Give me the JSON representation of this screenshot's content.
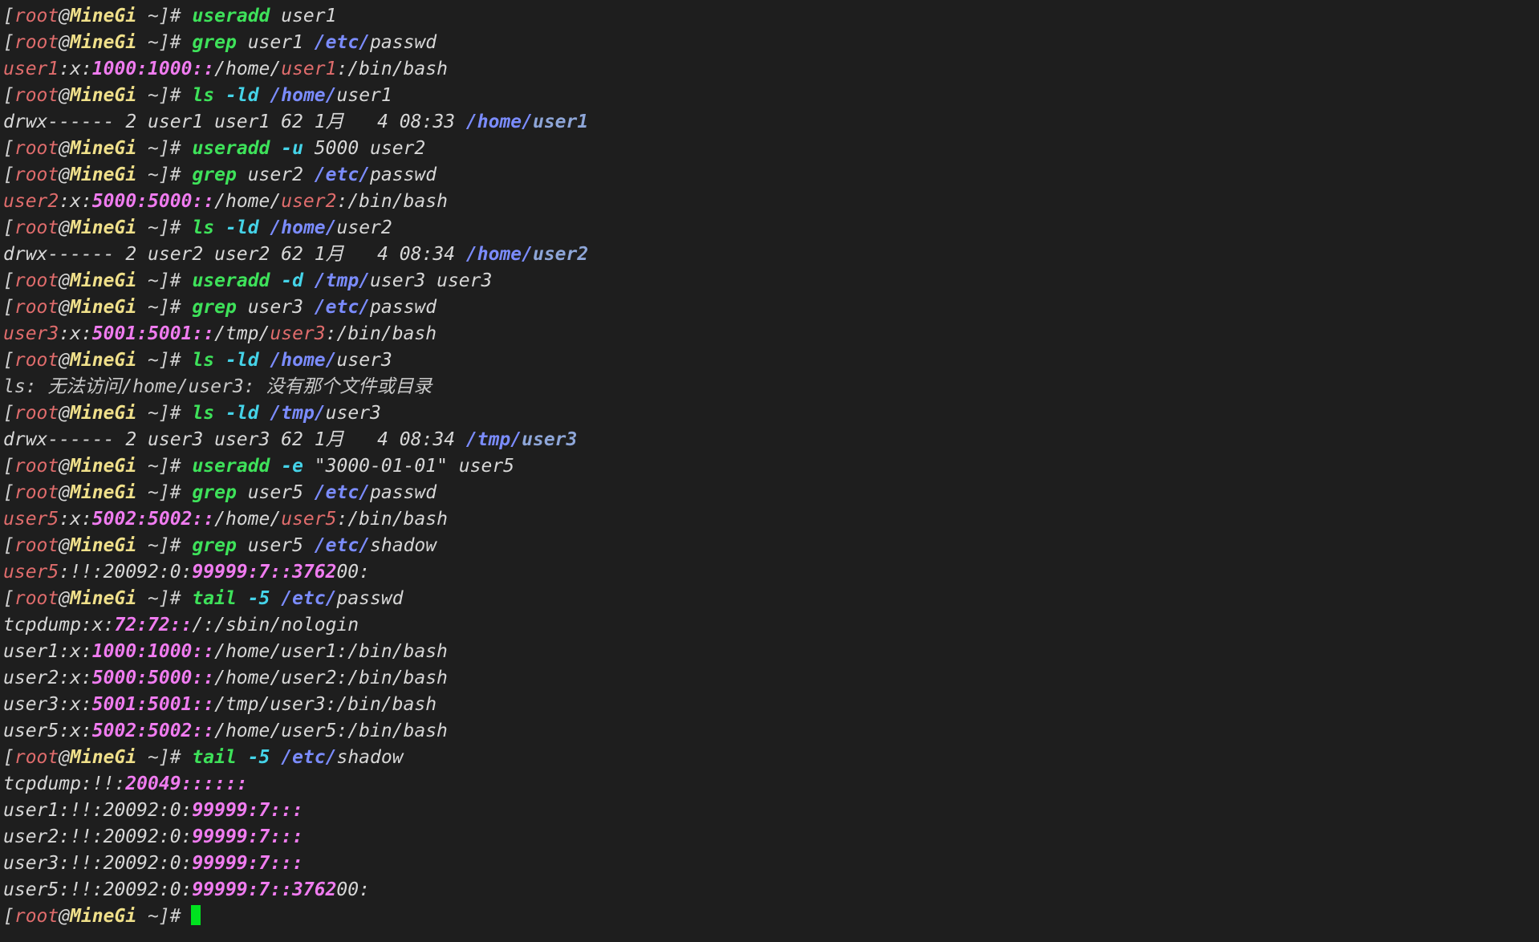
{
  "terminal": {
    "colors": {
      "background": "#1e1e1e",
      "default": "#d7d7d7",
      "red": "#e06c6c",
      "host": "#f0e08a",
      "green": "#3ee25a",
      "cyan": "#45d3e8",
      "blue": "#7b8cff",
      "magenta": "#f07cf0",
      "cursor": "#00e21f"
    },
    "cursor_icon": "block-cursor",
    "lines": [
      [
        [
          "[",
          "bracket"
        ],
        [
          "root",
          "red"
        ],
        [
          "@",
          "default"
        ],
        [
          "MineGi",
          "host"
        ],
        [
          " ~]",
          "bracket"
        ],
        [
          "# ",
          "bracket"
        ],
        [
          "useradd",
          "green"
        ],
        [
          " user1",
          "default"
        ]
      ],
      [
        [
          "[",
          "bracket"
        ],
        [
          "root",
          "red"
        ],
        [
          "@",
          "default"
        ],
        [
          "MineGi",
          "host"
        ],
        [
          " ~]",
          "bracket"
        ],
        [
          "# ",
          "bracket"
        ],
        [
          "grep",
          "green"
        ],
        [
          " user1 ",
          "default"
        ],
        [
          "/etc/",
          "blue"
        ],
        [
          "passwd",
          "default"
        ]
      ],
      [
        [
          "user1",
          "red"
        ],
        [
          ":x:",
          "default"
        ],
        [
          "1000:1000::",
          "magenta"
        ],
        [
          "/home/",
          "default"
        ],
        [
          "user1",
          "red"
        ],
        [
          ":/bin/bash",
          "default"
        ]
      ],
      [
        [
          "[",
          "bracket"
        ],
        [
          "root",
          "red"
        ],
        [
          "@",
          "default"
        ],
        [
          "MineGi",
          "host"
        ],
        [
          " ~]",
          "bracket"
        ],
        [
          "# ",
          "bracket"
        ],
        [
          "ls",
          "green"
        ],
        [
          " -ld ",
          "cyan"
        ],
        [
          "/home/",
          "blue"
        ],
        [
          "user1",
          "default"
        ]
      ],
      [
        [
          "drwx------ 2 user1 user1 62 1月   4 08:33 ",
          "default"
        ],
        [
          "/home/",
          "blue"
        ],
        [
          "user1",
          "steel"
        ]
      ],
      [
        [
          "[",
          "bracket"
        ],
        [
          "root",
          "red"
        ],
        [
          "@",
          "default"
        ],
        [
          "MineGi",
          "host"
        ],
        [
          " ~]",
          "bracket"
        ],
        [
          "# ",
          "bracket"
        ],
        [
          "useradd",
          "green"
        ],
        [
          " -u ",
          "cyan"
        ],
        [
          "5000 user2",
          "default"
        ]
      ],
      [
        [
          "[",
          "bracket"
        ],
        [
          "root",
          "red"
        ],
        [
          "@",
          "default"
        ],
        [
          "MineGi",
          "host"
        ],
        [
          " ~]",
          "bracket"
        ],
        [
          "# ",
          "bracket"
        ],
        [
          "grep",
          "green"
        ],
        [
          " user2 ",
          "default"
        ],
        [
          "/etc/",
          "blue"
        ],
        [
          "passwd",
          "default"
        ]
      ],
      [
        [
          "user2",
          "red"
        ],
        [
          ":x:",
          "default"
        ],
        [
          "5000:5000::",
          "magenta"
        ],
        [
          "/home/",
          "default"
        ],
        [
          "user2",
          "red"
        ],
        [
          ":/bin/bash",
          "default"
        ]
      ],
      [
        [
          "[",
          "bracket"
        ],
        [
          "root",
          "red"
        ],
        [
          "@",
          "default"
        ],
        [
          "MineGi",
          "host"
        ],
        [
          " ~]",
          "bracket"
        ],
        [
          "# ",
          "bracket"
        ],
        [
          "ls",
          "green"
        ],
        [
          " -ld ",
          "cyan"
        ],
        [
          "/home/",
          "blue"
        ],
        [
          "user2",
          "default"
        ]
      ],
      [
        [
          "drwx------ 2 user2 user2 62 1月   4 08:34 ",
          "default"
        ],
        [
          "/home/",
          "blue"
        ],
        [
          "user2",
          "steel"
        ]
      ],
      [
        [
          "[",
          "bracket"
        ],
        [
          "root",
          "red"
        ],
        [
          "@",
          "default"
        ],
        [
          "MineGi",
          "host"
        ],
        [
          " ~]",
          "bracket"
        ],
        [
          "# ",
          "bracket"
        ],
        [
          "useradd",
          "green"
        ],
        [
          " -d ",
          "cyan"
        ],
        [
          "/tmp/",
          "blue"
        ],
        [
          "user3 user3",
          "default"
        ]
      ],
      [
        [
          "[",
          "bracket"
        ],
        [
          "root",
          "red"
        ],
        [
          "@",
          "default"
        ],
        [
          "MineGi",
          "host"
        ],
        [
          " ~]",
          "bracket"
        ],
        [
          "# ",
          "bracket"
        ],
        [
          "grep",
          "green"
        ],
        [
          " user3 ",
          "default"
        ],
        [
          "/etc/",
          "blue"
        ],
        [
          "passwd",
          "default"
        ]
      ],
      [
        [
          "user3",
          "red"
        ],
        [
          ":x:",
          "default"
        ],
        [
          "5001:5001::",
          "magenta"
        ],
        [
          "/tmp/",
          "default"
        ],
        [
          "user3",
          "red"
        ],
        [
          ":/bin/bash",
          "default"
        ]
      ],
      [
        [
          "[",
          "bracket"
        ],
        [
          "root",
          "red"
        ],
        [
          "@",
          "default"
        ],
        [
          "MineGi",
          "host"
        ],
        [
          " ~]",
          "bracket"
        ],
        [
          "# ",
          "bracket"
        ],
        [
          "ls",
          "green"
        ],
        [
          " -ld ",
          "cyan"
        ],
        [
          "/home/",
          "blue"
        ],
        [
          "user3",
          "default"
        ]
      ],
      [
        [
          "ls: 无法访问/home/user3: 没有那个文件或目录",
          "error"
        ]
      ],
      [
        [
          "[",
          "bracket"
        ],
        [
          "root",
          "red"
        ],
        [
          "@",
          "default"
        ],
        [
          "MineGi",
          "host"
        ],
        [
          " ~]",
          "bracket"
        ],
        [
          "# ",
          "bracket"
        ],
        [
          "ls",
          "green"
        ],
        [
          " -ld ",
          "cyan"
        ],
        [
          "/tmp/",
          "blue"
        ],
        [
          "user3",
          "default"
        ]
      ],
      [
        [
          "drwx------ 2 user3 user3 62 1月   4 08:34 ",
          "default"
        ],
        [
          "/tmp/",
          "blue"
        ],
        [
          "user3",
          "steel"
        ]
      ],
      [
        [
          "[",
          "bracket"
        ],
        [
          "root",
          "red"
        ],
        [
          "@",
          "default"
        ],
        [
          "MineGi",
          "host"
        ],
        [
          " ~]",
          "bracket"
        ],
        [
          "# ",
          "bracket"
        ],
        [
          "useradd",
          "green"
        ],
        [
          " -e ",
          "cyan"
        ],
        [
          "\"3000-01-01\" user5",
          "default"
        ]
      ],
      [
        [
          "[",
          "bracket"
        ],
        [
          "root",
          "red"
        ],
        [
          "@",
          "default"
        ],
        [
          "MineGi",
          "host"
        ],
        [
          " ~]",
          "bracket"
        ],
        [
          "# ",
          "bracket"
        ],
        [
          "grep",
          "green"
        ],
        [
          " user5 ",
          "default"
        ],
        [
          "/etc/",
          "blue"
        ],
        [
          "passwd",
          "default"
        ]
      ],
      [
        [
          "user5",
          "red"
        ],
        [
          ":x:",
          "default"
        ],
        [
          "5002:5002::",
          "magenta"
        ],
        [
          "/home/",
          "default"
        ],
        [
          "user5",
          "red"
        ],
        [
          ":/bin/bash",
          "default"
        ]
      ],
      [
        [
          "[",
          "bracket"
        ],
        [
          "root",
          "red"
        ],
        [
          "@",
          "default"
        ],
        [
          "MineGi",
          "host"
        ],
        [
          " ~]",
          "bracket"
        ],
        [
          "# ",
          "bracket"
        ],
        [
          "grep",
          "green"
        ],
        [
          " user5 ",
          "default"
        ],
        [
          "/etc/",
          "blue"
        ],
        [
          "shadow",
          "default"
        ]
      ],
      [
        [
          "user5",
          "red"
        ],
        [
          ":!!:20092:0:",
          "default"
        ],
        [
          "99999:7::3762",
          "magenta"
        ],
        [
          "00:",
          "default"
        ]
      ],
      [
        [
          "[",
          "bracket"
        ],
        [
          "root",
          "red"
        ],
        [
          "@",
          "default"
        ],
        [
          "MineGi",
          "host"
        ],
        [
          " ~]",
          "bracket"
        ],
        [
          "# ",
          "bracket"
        ],
        [
          "tail",
          "green"
        ],
        [
          " -5 ",
          "cyan"
        ],
        [
          "/etc/",
          "blue"
        ],
        [
          "passwd",
          "default"
        ]
      ],
      [
        [
          "tcpdump:x:",
          "default"
        ],
        [
          "72:72::",
          "magenta"
        ],
        [
          "/:/sbin/nologin",
          "default"
        ]
      ],
      [
        [
          "user1:x:",
          "default"
        ],
        [
          "1000:1000::",
          "magenta"
        ],
        [
          "/home/user1:/bin/bash",
          "default"
        ]
      ],
      [
        [
          "user2:x:",
          "default"
        ],
        [
          "5000:5000::",
          "magenta"
        ],
        [
          "/home/user2:/bin/bash",
          "default"
        ]
      ],
      [
        [
          "user3:x:",
          "default"
        ],
        [
          "5001:5001::",
          "magenta"
        ],
        [
          "/tmp/user3:/bin/bash",
          "default"
        ]
      ],
      [
        [
          "user5:x:",
          "default"
        ],
        [
          "5002:5002::",
          "magenta"
        ],
        [
          "/home/user5:/bin/bash",
          "default"
        ]
      ],
      [
        [
          "[",
          "bracket"
        ],
        [
          "root",
          "red"
        ],
        [
          "@",
          "default"
        ],
        [
          "MineGi",
          "host"
        ],
        [
          " ~]",
          "bracket"
        ],
        [
          "# ",
          "bracket"
        ],
        [
          "tail",
          "green"
        ],
        [
          " -5 ",
          "cyan"
        ],
        [
          "/etc/",
          "blue"
        ],
        [
          "shadow",
          "default"
        ]
      ],
      [
        [
          "tcpdump:!!:",
          "default"
        ],
        [
          "20049::::::",
          "magenta"
        ]
      ],
      [
        [
          "user1:!!:20092:0:",
          "default"
        ],
        [
          "99999:7:::",
          "magenta"
        ]
      ],
      [
        [
          "user2:!!:20092:0:",
          "default"
        ],
        [
          "99999:7:::",
          "magenta"
        ]
      ],
      [
        [
          "user3:!!:20092:0:",
          "default"
        ],
        [
          "99999:7:::",
          "magenta"
        ]
      ],
      [
        [
          "user5:!!:20092:0:",
          "default"
        ],
        [
          "99999:7::3762",
          "magenta"
        ],
        [
          "00:",
          "default"
        ]
      ],
      [
        [
          "[",
          "bracket"
        ],
        [
          "root",
          "red"
        ],
        [
          "@",
          "default"
        ],
        [
          "MineGi",
          "host"
        ],
        [
          " ~]",
          "bracket"
        ],
        [
          "#",
          "bracket"
        ]
      ]
    ]
  }
}
